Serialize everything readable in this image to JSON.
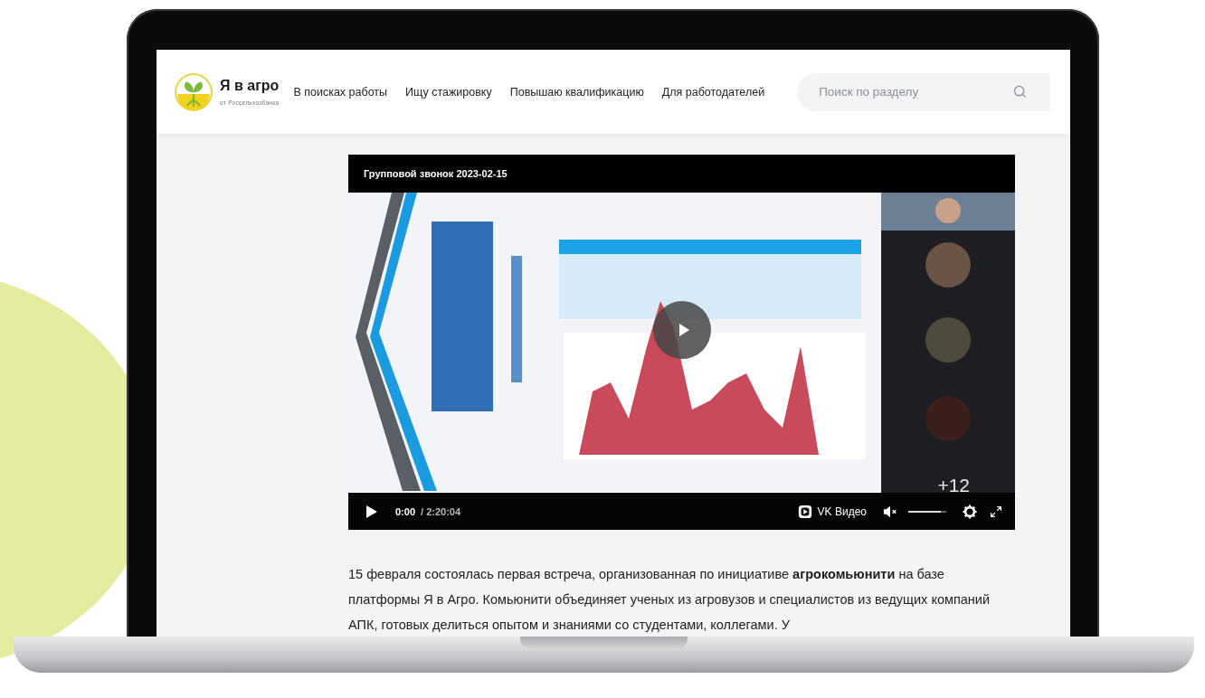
{
  "logo": {
    "title": "Я в агро",
    "subtitle": "от Россельхозбанка"
  },
  "nav": [
    {
      "label": "В поисках работы"
    },
    {
      "label": "Ищу стажировку"
    },
    {
      "label": "Повышаю квалификацию"
    },
    {
      "label": "Для работодателей"
    }
  ],
  "search": {
    "placeholder": "Поиск по разделу"
  },
  "video": {
    "title": "Групповой звонок 2023-02-15",
    "participants_more": "+12",
    "playing": false,
    "time_current": "0:00",
    "time_total": "/ 2:20:04",
    "brand": "VK Видео",
    "muted": true,
    "volume": {
      "level": 0.85
    }
  },
  "article": {
    "paragraphs": [
      "15 февраля состоялась первая встреча, организованная по инициативе **агрокомьюнити** на базе платформы Я в Агро. Комьюнити объединяет ученых из агровузов и специалистов из ведущих компаний АПК, готовых делиться опытом и знаниями со студентами, коллегами. У"
    ]
  }
}
